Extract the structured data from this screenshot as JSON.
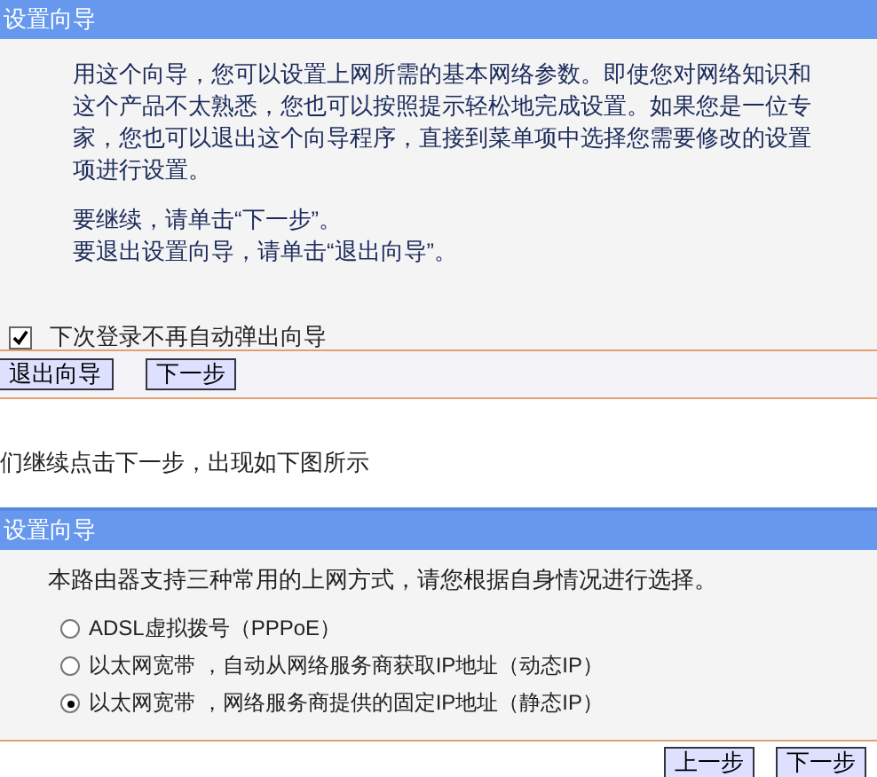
{
  "wizard": {
    "title": "设置向导",
    "paragraphs": [
      "用这个向导，您可以设置上网所需的基本网络参数。即使您对网络知识和这个产品不太熟悉，您也可以按照提示轻松地完成设置。如果您是一位专家，您也可以退出这个向导程序，直接到菜单项中选择您需要修改的设置项进行设置。",
      "要继续，请单击“下一步”。",
      "要退出设置向导，请单击“退出向导”。"
    ],
    "checkbox": {
      "label": "下次登录不再自动弹出向导",
      "checked": true
    },
    "buttons": [
      "退出向导",
      "下一步"
    ]
  },
  "caption": "们继续点击下一步，出现如下图所示",
  "wizard_2": {
    "title": "设置向导",
    "intro": "本路由器支持三种常用的上网方式，请您根据自身情况进行选择。",
    "options": [
      {
        "label": "ADSL虚拟拨号（PPPoE）",
        "selected": false
      },
      {
        "label": "以太网宽带 ，自动从网络服务商获取IP地址（动态IP）",
        "selected": false
      },
      {
        "label": "以太网宽带 ，网络服务商提供的固定IP地址（静态IP）",
        "selected": true
      }
    ],
    "buttons": [
      "上一步",
      "下一步"
    ]
  }
}
